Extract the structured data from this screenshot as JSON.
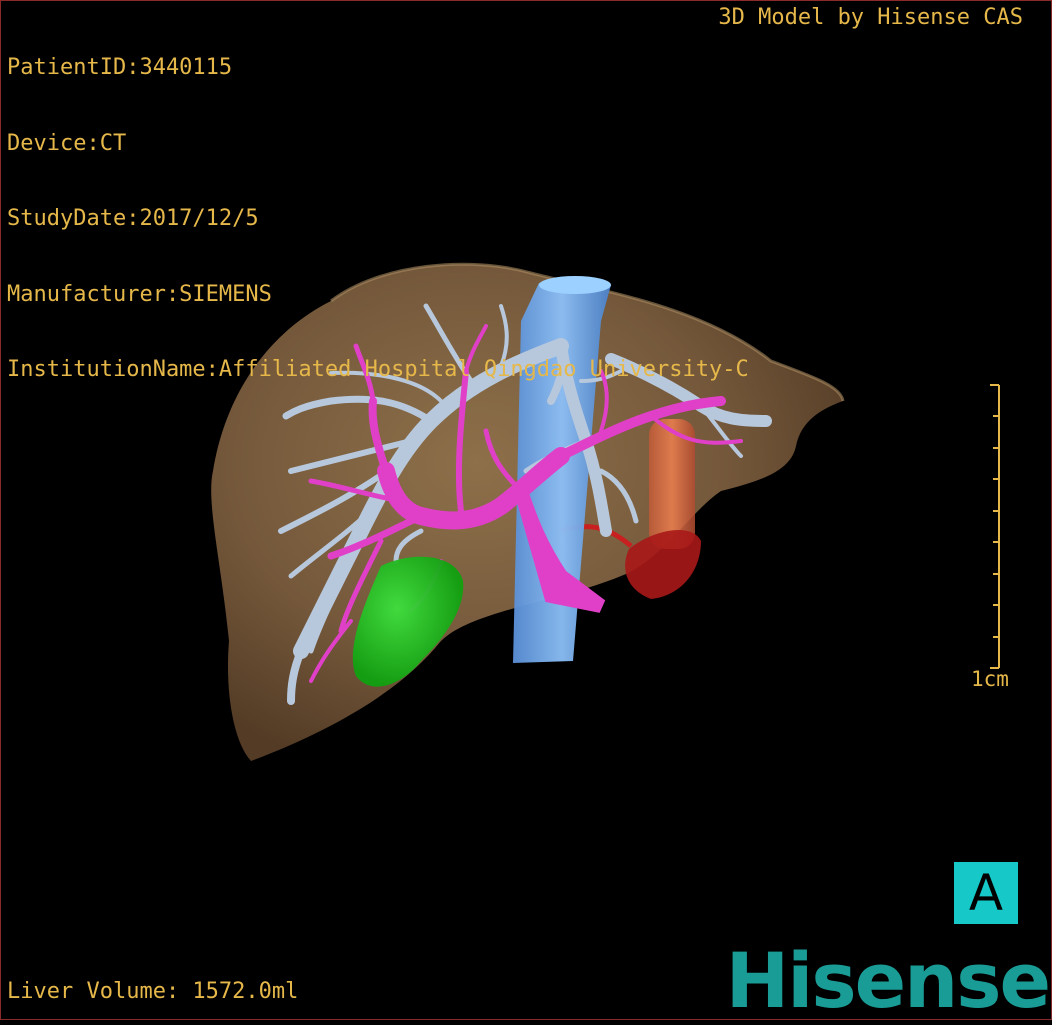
{
  "study_info": {
    "patient_id": "PatientID:3440115",
    "device": "Device:CT",
    "study_date": "StudyDate:2017/12/5",
    "manufacturer": "Manufacturer:SIEMENS",
    "institution": "InstitutionName:Affiliated Hospital Qingdao University-C"
  },
  "model_credit": "3D Model by Hisense CAS",
  "liver_volume": "Liver Volume: 1572.0ml",
  "scale_bar": {
    "label": "1cm"
  },
  "orientation_marker": "A",
  "brand_logo": "Hisense",
  "colors": {
    "overlay_text": "#e6b84a",
    "liver": "#8a6a42",
    "hepatic_veins": "#b8c8dc",
    "portal_vein": "#e040c8",
    "vena_cava": "#6aaaf0",
    "gallbladder": "#22c422",
    "lesion": "#c42020",
    "tumor": "#e07040",
    "orientation_marker_bg": "#16c8c8",
    "brand": "#1a9c96"
  }
}
